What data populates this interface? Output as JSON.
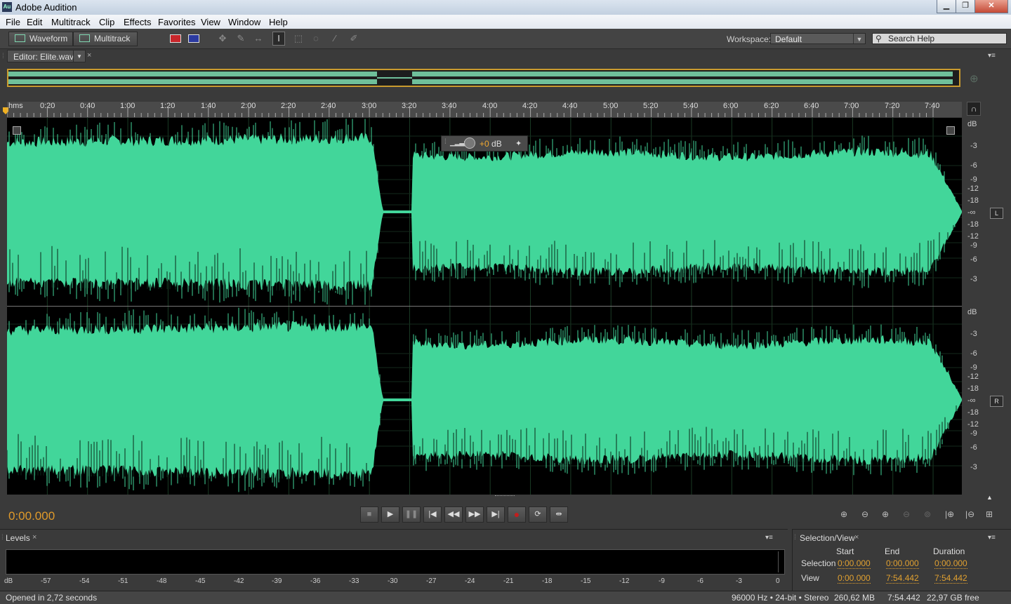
{
  "window": {
    "title": "Adobe Audition",
    "app_icon": "Au",
    "controls": {
      "minimize": "▁",
      "maximize": "❐",
      "close": "✕"
    }
  },
  "menu": [
    "File",
    "Edit",
    "Multitrack",
    "Clip",
    "Effects",
    "Favorites",
    "View",
    "Window",
    "Help"
  ],
  "toolbar": {
    "waveform_label": "Waveform",
    "multitrack_label": "Multitrack",
    "workspace_label": "Workspace:",
    "workspace_value": "Default",
    "search_placeholder": "Search Help"
  },
  "editor": {
    "tab_label": "Editor: Elite.wav",
    "ruler_labels": [
      "hms",
      "0:20",
      "0:40",
      "1:00",
      "1:20",
      "1:40",
      "2:00",
      "2:20",
      "2:40",
      "3:00",
      "3:20",
      "3:40",
      "4:00",
      "4:20",
      "4:40",
      "5:00",
      "5:20",
      "5:40",
      "6:00",
      "6:20",
      "6:40",
      "7:00",
      "7:20",
      "7:40"
    ],
    "db_labels_top": [
      "dB",
      "-3",
      "-6",
      "-9",
      "-12",
      "-18",
      "-∞",
      "-18",
      "-12",
      "-9",
      "-6",
      "-3"
    ],
    "db_labels_bottom": [
      "dB",
      "-3",
      "-6",
      "-9",
      "-12",
      "-18",
      "-∞",
      "-18",
      "-12",
      "-9",
      "-6",
      "-3"
    ],
    "channel_left": "L",
    "channel_right": "R",
    "hud_db_value": "+0",
    "hud_db_unit": " dB",
    "waveform_color": "#42d69a"
  },
  "transport": {
    "time": "0:00.000",
    "buttons": [
      "stop",
      "play",
      "pause",
      "move-to-previous",
      "rewind",
      "fast-forward",
      "move-to-next",
      "record",
      "loop-playback",
      "skip-selection"
    ]
  },
  "levels": {
    "tab_label": "Levels",
    "scale": [
      "dB",
      "-57",
      "-54",
      "-51",
      "-48",
      "-45",
      "-42",
      "-39",
      "-36",
      "-33",
      "-30",
      "-27",
      "-24",
      "-21",
      "-18",
      "-15",
      "-12",
      "-9",
      "-6",
      "-3",
      "0"
    ]
  },
  "selection_view": {
    "tab_label": "Selection/View",
    "headers": [
      "Start",
      "End",
      "Duration"
    ],
    "rows": [
      {
        "label": "Selection",
        "start": "0:00.000",
        "end": "0:00.000",
        "duration": "0:00.000"
      },
      {
        "label": "View",
        "start": "0:00.000",
        "end": "7:54.442",
        "duration": "7:54.442"
      }
    ]
  },
  "status": {
    "message": "Opened in 2,72 seconds",
    "format": "96000 Hz • 24-bit • Stereo",
    "size": "260,62 MB",
    "duration": "7:54.442",
    "free": "22,97 GB free"
  }
}
